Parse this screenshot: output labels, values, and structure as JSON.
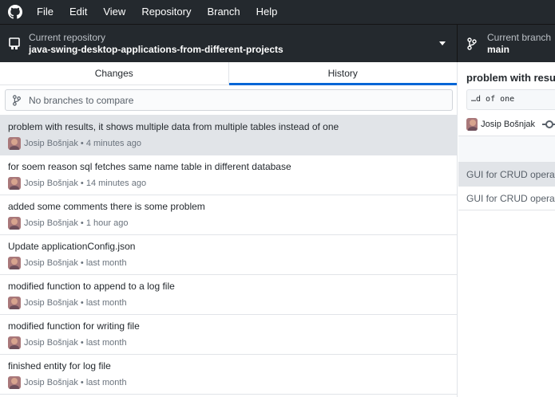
{
  "menu": [
    "File",
    "Edit",
    "View",
    "Repository",
    "Branch",
    "Help"
  ],
  "toolbar": {
    "repo_caption": "Current repository",
    "repo_name": "java-swing-desktop-applications-from-different-projects",
    "branch_caption": "Current branch",
    "branch_name": "main"
  },
  "tabs": {
    "changes": "Changes",
    "history": "History",
    "selected": "History"
  },
  "compare": {
    "placeholder": "No branches to compare"
  },
  "commits": [
    {
      "summary": "problem with results, it shows multiple data from multiple tables instead of one",
      "author": "Josip Bošnjak",
      "time": "4 minutes ago"
    },
    {
      "summary": "for soem reason sql fetches same name table in different database",
      "author": "Josip Bošnjak",
      "time": "14 minutes ago"
    },
    {
      "summary": "added some comments there is some problem",
      "author": "Josip Bošnjak",
      "time": "1 hour ago"
    },
    {
      "summary": "Update applicationConfig.json",
      "author": "Josip Bošnjak",
      "time": "last month"
    },
    {
      "summary": "modified function to append to a log file",
      "author": "Josip Bošnjak",
      "time": "last month"
    },
    {
      "summary": "modified function for writing file",
      "author": "Josip Bošnjak",
      "time": "last month"
    },
    {
      "summary": "finished entity for log file",
      "author": "Josip Bošnjak",
      "time": "last month"
    }
  ],
  "detail": {
    "title": "problem with resu",
    "description": "…d of one",
    "author": "Josip Bošnjak",
    "files": [
      "GUI for CRUD operat",
      "GUI for CRUD operat"
    ]
  },
  "colors": {
    "toolbar_bg": "#24292e",
    "accent": "#0366d6",
    "selected_bg": "#e1e4e8"
  }
}
